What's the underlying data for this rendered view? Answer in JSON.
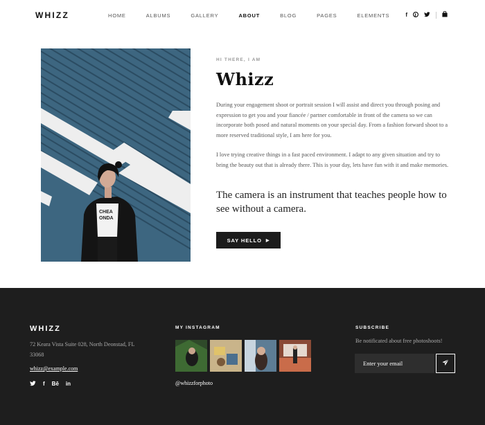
{
  "header": {
    "logo": "WHIZZ",
    "nav": [
      "HOME",
      "ALBUMS",
      "GALLERY",
      "ABOUT",
      "BLOG",
      "PAGES",
      "ELEMENTS"
    ],
    "active_nav": "ABOUT",
    "icons": {
      "facebook": "f",
      "pinterest": "P",
      "twitter": "🐦",
      "cart": "🛍"
    }
  },
  "intro": {
    "eyebrow": "HI THERE, I AM",
    "title": "Whizz",
    "paragraph1": "During your engagement shoot or portrait session I will assist and direct you through posing and expression to get you and your fiancée / partner comfortable in front of the camera so we can incorporate both posed and natural moments on your special day. From a fashion forward shoot to a more reserved traditional style, I am here for you.",
    "paragraph2": "I love trying creative things in a fast paced environment. I adapt to any given situation and try to bring the beauty out that is already there. This is your day, lets have fun with it and make memories.",
    "quote": "The camera is an instrument that teaches people how to see without a camera.",
    "button": "SAY HELLO",
    "button_icon": "▶",
    "photo_shirt_text": "CHEA\nONDA"
  },
  "footer": {
    "logo": "WHIZZ",
    "address": "72 Keara Vista Suite 028, North Deonstad, FL 33068",
    "email": "whizz@example.com",
    "social": [
      "🐦",
      "f",
      "Bē",
      "in"
    ],
    "instagram_heading": "MY INSTAGRAM",
    "instagram_handle": "@whizzforphoto",
    "subscribe_heading": "SUBSCRIBE",
    "subscribe_text": "Be notificated about free photoshoots!",
    "subscribe_placeholder": "Enter your email",
    "subscribe_icon": "paper-plane-icon"
  },
  "colors": {
    "footer_bg": "#1e1e1e",
    "button_bg": "#1c1c1c",
    "wall_blue": "#3b5f78"
  }
}
